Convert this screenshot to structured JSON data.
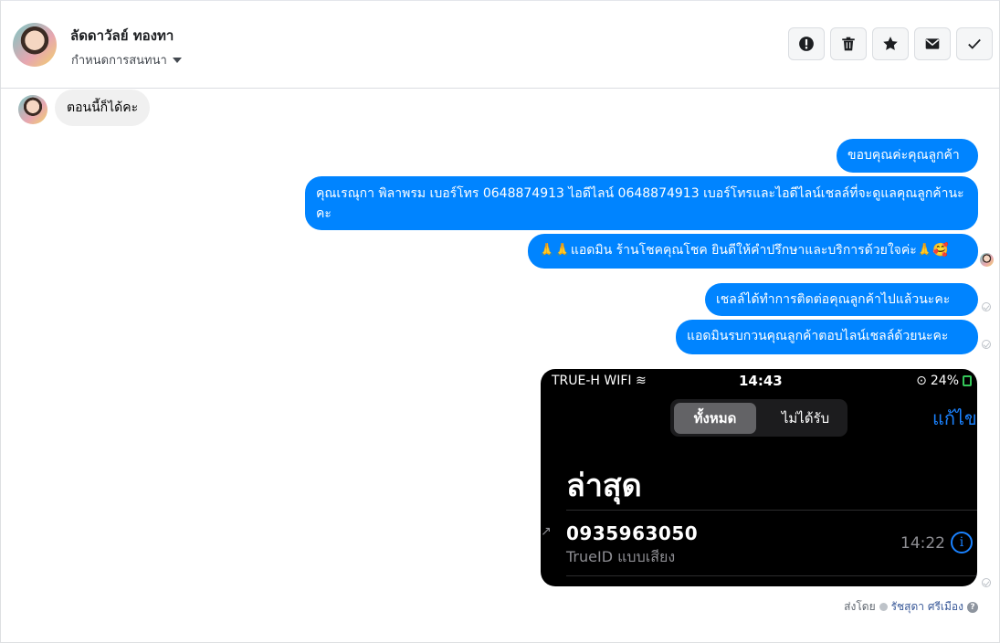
{
  "header": {
    "name": "ลัดดาวัลย์ ทองทา",
    "assign_label": "กำหนดการสนทนา",
    "actions": [
      "report-icon",
      "trash-icon",
      "star-icon",
      "mail-icon",
      "check-icon"
    ]
  },
  "incoming": {
    "text": "ตอนนี้ก็ได้คะ"
  },
  "outgoing": [
    {
      "text": "ขอบคุณค่ะคุณลูกค้า"
    },
    {
      "text": "คุณเรณุกา พิลาพรม      เบอร์โทร 0648874913  ไอดีไลน์ 0648874913   เบอร์โทรและไอดีไลน์เชลล์ที่จะดูแลคุณลูกค้านะคะ"
    },
    {
      "text": "🙏🙏แอดมิน ร้านโชคคุณโชค ยินดีให้คำปรึกษาและบริการด้วยใจค่ะ🙏🥰"
    },
    {
      "text": "เชลล์ได้ทำการติดต่อคุณลูกค้าไปแล้วนะคะ"
    },
    {
      "text": "แอดมินรบกวนคุณลูกค้าตอบไลน์เชลล์ด้วยนะคะ"
    }
  ],
  "screenshot": {
    "carrier": "TRUE-H WIFI",
    "time": "14:43",
    "battery": "24%",
    "seg_all": "ทั้งหมด",
    "seg_missed": "ไม่ได้รับ",
    "edit": "แก้ไข",
    "title": "ล่าสุด",
    "number": "0935963050",
    "call_type": "TrueID แบบเสียง",
    "call_time": "14:22"
  },
  "footer": {
    "sent_by_label": "ส่งโดย",
    "sender": "รัชสุดา ศรีเมือง"
  },
  "colors": {
    "bubble_out": "#0084ff",
    "bubble_in": "#f0f0f0"
  }
}
